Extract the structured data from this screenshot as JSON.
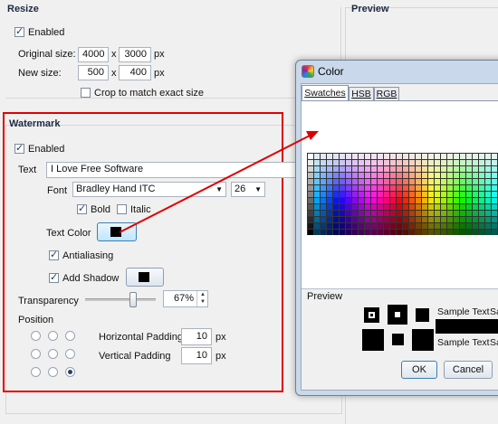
{
  "resize": {
    "title": "Resize",
    "enabled_label": "Enabled",
    "original_size_label": "Original size:",
    "original_w": "4000",
    "original_h": "3000",
    "new_size_label": "New size:",
    "new_w": "500",
    "new_h": "400",
    "x_sep": "x",
    "px": "px",
    "crop_label": "Crop to match exact size"
  },
  "preview": {
    "title": "Preview"
  },
  "watermark": {
    "title": "Watermark",
    "enabled_label": "Enabled",
    "text_label": "Text",
    "text_value": "I Love Free Software",
    "font_label": "Font",
    "font_value": "Bradley Hand ITC",
    "size_value": "26",
    "bold_label": "Bold",
    "italic_label": "Italic",
    "text_color_label": "Text Color",
    "antialiasing_label": "Antialiasing",
    "add_shadow_label": "Add Shadow",
    "transparency_label": "Transparency",
    "transparency_value": "67%",
    "transparency_level": 0.67,
    "position_label": "Position",
    "h_padding_label": "Horizontal Padding",
    "h_padding_value": "10",
    "v_padding_label": "Vertical Padding",
    "v_padding_value": "10",
    "px": "px"
  },
  "dialog": {
    "title": "Color",
    "tabs": [
      "Swatches",
      "HSB",
      "RGB"
    ],
    "preview_label": "Preview",
    "sample_text": "Sample Text",
    "sample_cut": "Sa",
    "ok": "OK",
    "cancel": "Cancel"
  },
  "colors": {
    "highlight": "#e00000",
    "group_title": "#1e2a44",
    "swatch_black": "#000000"
  }
}
